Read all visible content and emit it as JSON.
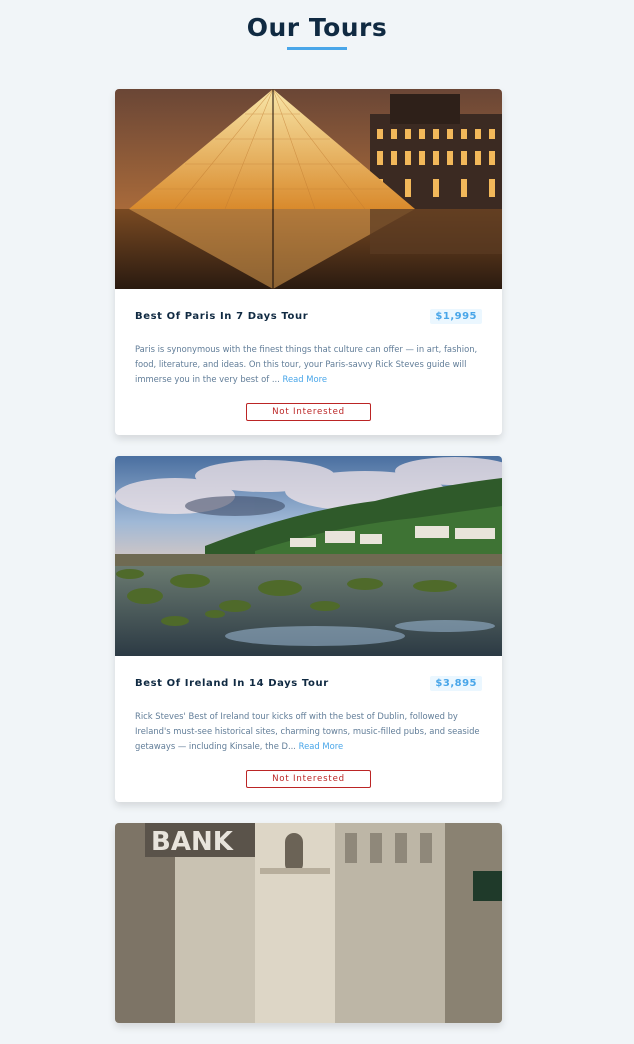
{
  "header": {
    "title": "Our Tours"
  },
  "tours": [
    {
      "name": "Best Of Paris In 7 Days Tour",
      "price": "$1,995",
      "description": "Paris is synonymous with the finest things that culture can offer — in art, fashion, food, literature, and ideas. On this tour, your Paris-savvy Rick Steves guide will immerse you in the very best of ...",
      "read_more": "Read More",
      "button": "Not Interested",
      "image": "louvre-pyramid-photo"
    },
    {
      "name": "Best Of Ireland In 14 Days Tour",
      "price": "$3,895",
      "description": "Rick Steves' Best of Ireland tour kicks off with the best of Dublin, followed by Ireland's must-see historical sites, charming towns, music-filled pubs, and seaside getaways — including Kinsale, the D...",
      "read_more": "Read More",
      "button": "Not Interested",
      "image": "ireland-coast-photo"
    },
    {
      "image": "vienna-street-photo",
      "sign_text": "BANK"
    }
  ]
}
